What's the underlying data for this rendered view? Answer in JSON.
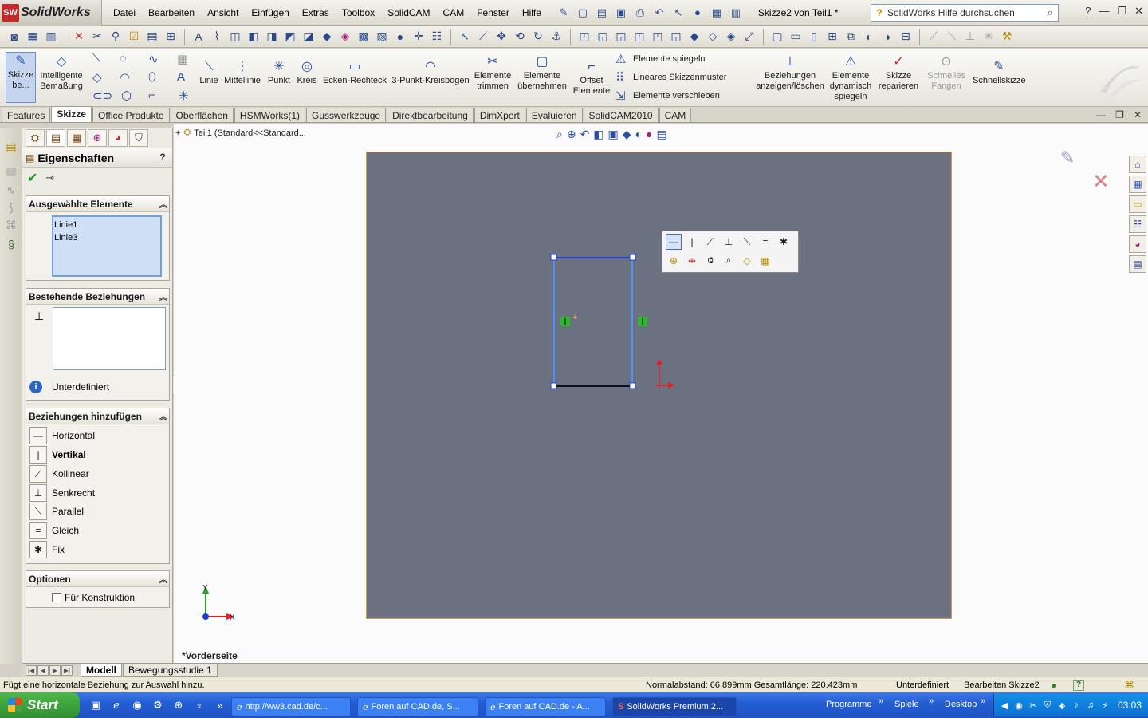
{
  "app": {
    "logo": "SolidWorks",
    "logo_badge": "SW",
    "menus": [
      "Datei",
      "Bearbeiten",
      "Ansicht",
      "Einfügen",
      "Extras",
      "Toolbox",
      "SolidCAM",
      "CAM",
      "Fenster",
      "Hilfe"
    ],
    "doc_title": "Skizze2 von Teil1 *",
    "help_search_placeholder": "SolidWorks Hilfe durchsuchen"
  },
  "commands": {
    "sketch": "Skizze be...",
    "smart_dim": "Intelligente Bemaßung",
    "line": "Linie",
    "centerline": "Mittellinie",
    "point": "Punkt",
    "circle": "Kreis",
    "corner_rect": "Ecken-Rechteck",
    "arc3": "3-Punkt-Kreisbogen",
    "trim": "Elemente trimmen",
    "convert": "Elemente übernehmen",
    "offset": "Offset Elemente",
    "mirror": "Elemente spiegeln",
    "linear_pattern": "Lineares Skizzenmuster",
    "move": "Elemente verschieben",
    "relations": "Beziehungen anzeigen/löschen",
    "dyn_mirror": "Elemente dynamisch spiegeln",
    "repair": "Skizze reparieren",
    "quick_snap": "Schnelles Fangen",
    "rapid_sketch": "Schnellskizze"
  },
  "tabs": [
    "Features",
    "Skizze",
    "Office Produkte",
    "Oberflächen",
    "HSMWorks(1)",
    "Gusswerkzeuge",
    "Direktbearbeitung",
    "DimXpert",
    "Evaluieren",
    "SolidCAM2010",
    "CAM"
  ],
  "active_tab": "Skizze",
  "property_manager": {
    "title": "Eigenschaften",
    "help": "?",
    "selected_group": "Ausgewählte Elemente",
    "selected_items": [
      "Linie1",
      "Linie3"
    ],
    "existing_group": "Bestehende Beziehungen",
    "status": "Unterdefiniert",
    "add_group": "Beziehungen hinzufügen",
    "relations": [
      {
        "label": "Horizontal",
        "glyph": "—",
        "bold": false
      },
      {
        "label": "Vertikal",
        "glyph": "|",
        "bold": true
      },
      {
        "label": "Kollinear",
        "glyph": "⟋",
        "bold": false
      },
      {
        "label": "Senkrecht",
        "glyph": "⊥",
        "bold": false
      },
      {
        "label": "Parallel",
        "glyph": "⟍",
        "bold": false
      },
      {
        "label": "Gleich",
        "glyph": "=",
        "bold": false
      },
      {
        "label": "Fix",
        "glyph": "✱",
        "bold": false
      }
    ],
    "options_group": "Optionen",
    "construction_label": "Für Konstruktion"
  },
  "tree_head": "Teil1  (Standard<<Standard...",
  "view_label": "*Vorderseite",
  "axis": {
    "x": "X",
    "y": "Y"
  },
  "bottom_tabs": [
    "Modell",
    "Bewegungsstudie 1"
  ],
  "status": {
    "message": "Fügt eine horizontale Beziehung zur Auswahl hinzu.",
    "distance": "Normalabstand: 66.899mm Gesamtlänge: 220.423mm",
    "state": "Unterdefiniert",
    "editing": "Bearbeiten Skizze2",
    "help": "?"
  },
  "taskbar": {
    "start": "Start",
    "items": [
      "http://ww3.cad.de/c...",
      "Foren auf CAD.de, S...",
      "Foren auf CAD.de - A...",
      "SolidWorks Premium 2..."
    ],
    "links": [
      "Programme",
      "Spiele",
      "Desktop"
    ],
    "clock": "03:03"
  },
  "colors": {
    "sheet": "#6c7181",
    "sketch_line": "#2e7be0",
    "accent": "#2b4da0"
  }
}
